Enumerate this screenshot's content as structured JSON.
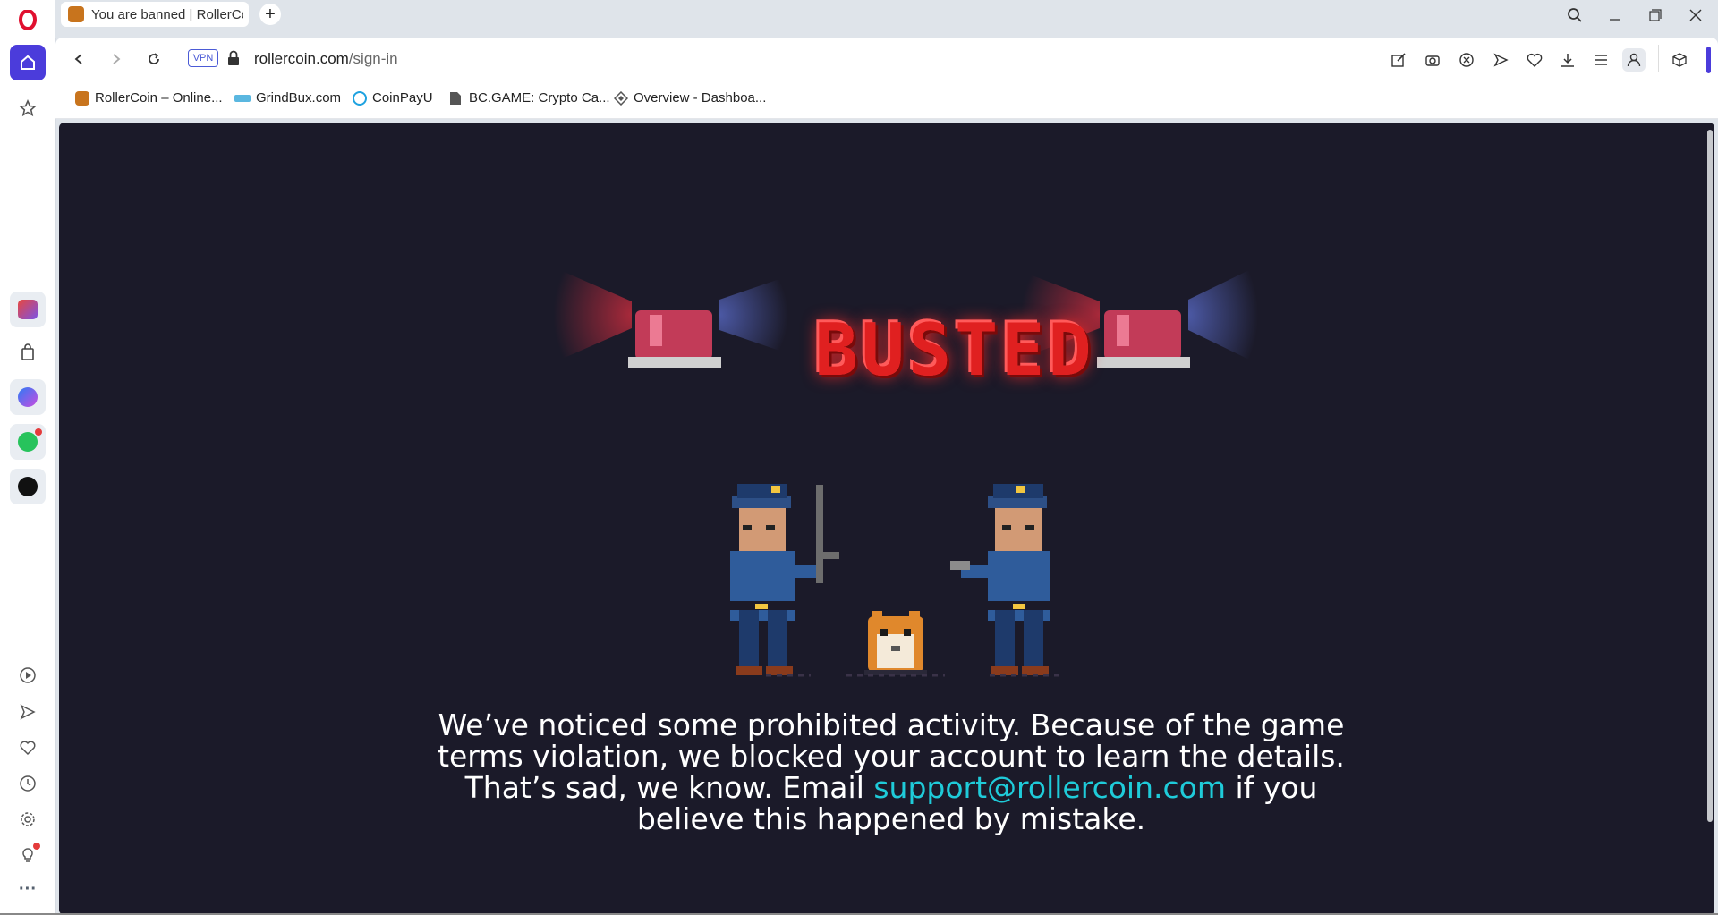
{
  "browser": {
    "tab_title": "You are banned | RollerCoin",
    "url_host": "rollercoin.com",
    "url_path": "/sign-in",
    "vpn_label": "VPN",
    "accent_color": "#4b3cdb"
  },
  "bookmarks": [
    {
      "label": "RollerCoin – Online...",
      "icon": "hamster-icon"
    },
    {
      "label": "GrindBux.com",
      "icon": "grindbux-icon"
    },
    {
      "label": "CoinPayU",
      "icon": "coinpayu-icon"
    },
    {
      "label": "BC.GAME: Crypto Ca...",
      "icon": "document-icon"
    },
    {
      "label": "Overview - Dashboa...",
      "icon": "diamond-icon"
    }
  ],
  "page": {
    "heading": "BUSTED",
    "message_part1": "We’ve noticed some prohibited activity. Because of the game terms violation, we blocked your account to learn the details. That’s sad, we know. Email ",
    "email": "support@rollercoin.com",
    "message_part2": " if you believe this happened by mistake.",
    "background_color": "#1b1a29",
    "email_color": "#1fcbd9"
  }
}
